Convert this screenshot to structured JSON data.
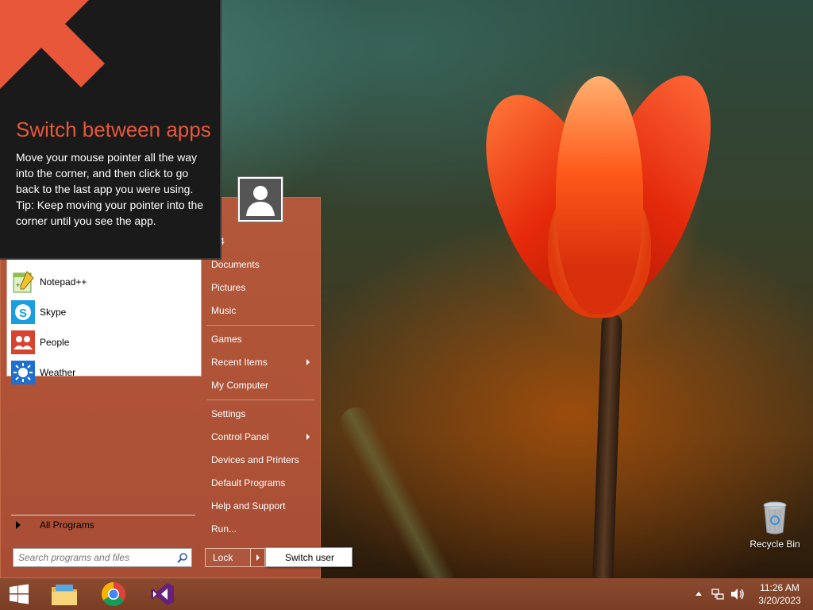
{
  "tooltip": {
    "title": "Switch between apps",
    "body": "Move your mouse pointer all the way into the corner, and then click to go back to the last app you were using.",
    "tip": "Tip: Keep moving your pointer into the corner until you see the app."
  },
  "start_menu": {
    "pinned": [
      {
        "label": "Notepad++",
        "icon": "notepadpp-icon"
      },
      {
        "label": "Skype",
        "icon": "skype-icon"
      },
      {
        "label": "People",
        "icon": "people-icon"
      },
      {
        "label": "Weather",
        "icon": "weather-icon"
      }
    ],
    "all_programs": "All Programs",
    "search_placeholder": "Search programs and files",
    "right_links": [
      {
        "label": "M4"
      },
      {
        "label": "Documents"
      },
      {
        "label": "Pictures"
      },
      {
        "label": "Music"
      },
      {
        "label": "Games"
      },
      {
        "label": "Recent Items"
      },
      {
        "label": "My Computer"
      },
      {
        "label": "Settings"
      },
      {
        "label": "Control Panel"
      },
      {
        "label": "Devices and Printers"
      },
      {
        "label": "Default Programs"
      },
      {
        "label": "Help and Support"
      },
      {
        "label": "Run..."
      }
    ],
    "lock_label": "Lock",
    "switch_user_label": "Switch user"
  },
  "desktop": {
    "recycle_bin": "Recycle Bin"
  },
  "taskbar": {
    "apps": [
      "windows-start-icon",
      "file-explorer-icon",
      "chrome-icon",
      "visual-studio-icon"
    ],
    "time": "11:26 AM",
    "date": "3/20/2023"
  },
  "colors": {
    "start_menu": "#b85a3a",
    "taskbar": "#7f4128",
    "tooltip_title": "#e8573a",
    "tooltip_bg": "#1a1a1a"
  }
}
